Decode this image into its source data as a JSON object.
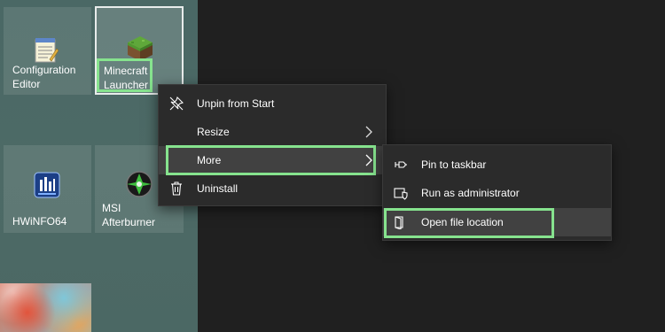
{
  "tiles": {
    "configuration_editor": "Configuration\nEditor",
    "minecraft_launcher": "Minecraft\nLauncher",
    "hwinfo": "HWiNFO64",
    "msi_afterburner": "MSI\nAfterburner"
  },
  "context_menu": {
    "unpin": "Unpin from Start",
    "resize": "Resize",
    "more": "More",
    "uninstall": "Uninstall"
  },
  "submenu": {
    "pin_taskbar": "Pin to taskbar",
    "run_admin": "Run as administrator",
    "open_location": "Open file location"
  },
  "colors": {
    "highlight": "#86e38e",
    "menu_bg": "#2b2b2b",
    "hover_bg": "#414141",
    "start_panel": "#4b6864"
  },
  "icons": {
    "unpin": "unpin-icon",
    "uninstall": "trash-icon",
    "pin_taskbar": "pin-icon",
    "run_admin": "shield-icon",
    "open_location": "folder-icon"
  }
}
